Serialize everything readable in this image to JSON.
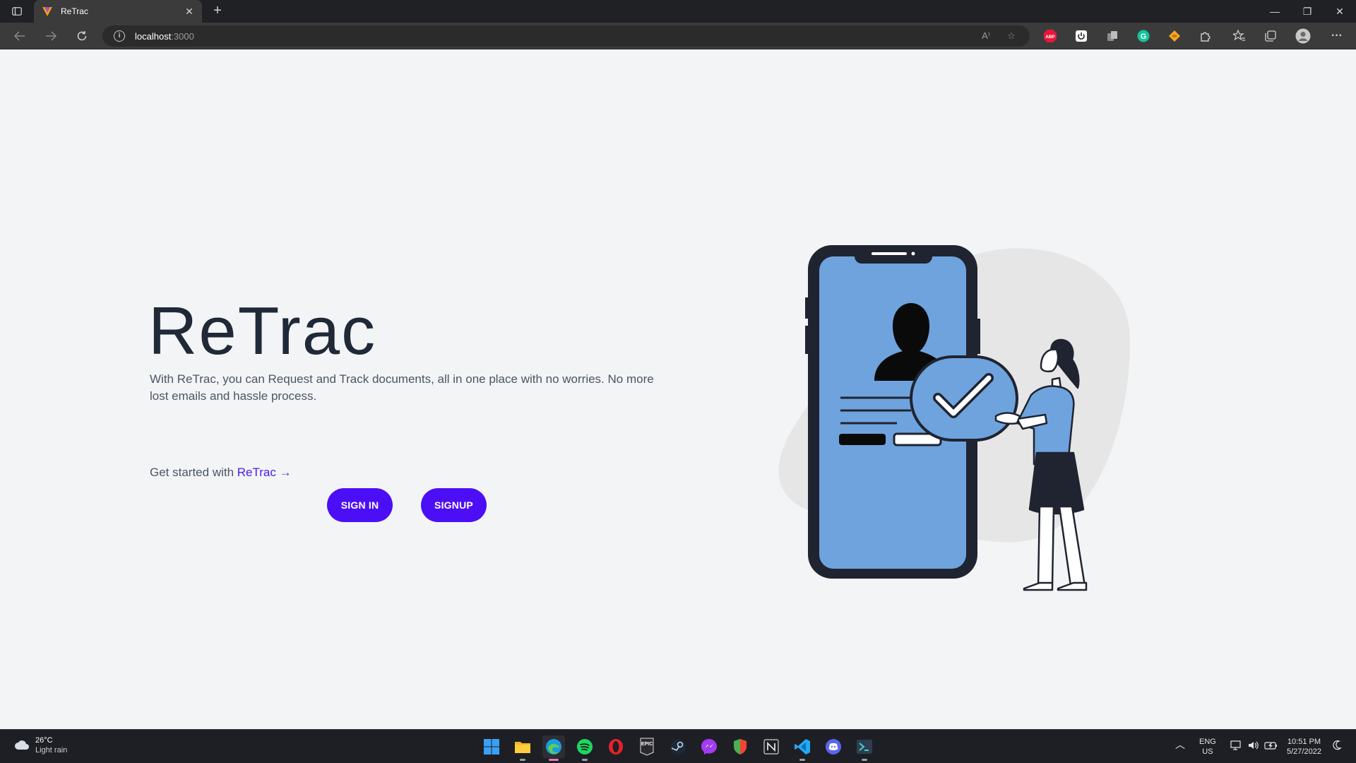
{
  "browser": {
    "tab_title": "ReTrac",
    "tab_close": "✕",
    "new_tab": "+",
    "url_host": "localhost",
    "url_port": ":3000",
    "window_controls": {
      "minimize": "—",
      "restore": "❐",
      "close": "✕"
    }
  },
  "extensions": [
    "ABP",
    "power-icon",
    "copy-icon",
    "G",
    "tag-icon",
    "puzzle-icon"
  ],
  "hero": {
    "title": "ReTrac",
    "description": "With ReTrac, you can Request and Track documents, all in one place with no worries. No more lost emails and hassle process.",
    "get_started_prefix": "Get started with ",
    "get_started_link": "ReTrac →",
    "signin_label": "SIGN IN",
    "signup_label": "SIGNUP"
  },
  "colors": {
    "accent": "#4c0ff5",
    "title": "#1f2937",
    "phone_screen": "#6fa3de",
    "phone_frame": "#1f2430"
  },
  "taskbar": {
    "weather_temp": "26°C",
    "weather_cond": "Light rain",
    "lang": "ENG",
    "region": "US",
    "time": "10:51 PM",
    "date": "5/27/2022",
    "apps": [
      "windows-start-icon",
      "file-explorer-icon",
      "edge-icon",
      "spotify-icon",
      "opera-icon",
      "epic-games-icon",
      "steam-icon",
      "messenger-icon",
      "shield-browser-icon",
      "notion-icon",
      "vscode-icon",
      "discord-icon",
      "terminal-icon"
    ],
    "epic_label": "EPIC"
  }
}
